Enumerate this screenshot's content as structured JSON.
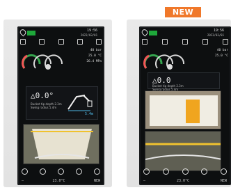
{
  "badge": {
    "label": "NEW",
    "color": "#f0782a"
  },
  "left_screen": {
    "status": {
      "time": "19:56",
      "date": "2023/03/01"
    },
    "readings": [
      "40 bar",
      "25.0 °C",
      "26.4 MPa"
    ],
    "angle": "△0.0°",
    "angle_caption_1": "Bucket tip depth 2.3m",
    "angle_caption_2": "Swing radius 5.4m",
    "distance": "5.4m",
    "footer_left": "—",
    "footer_center": "23.0°C",
    "footer_right": "NEW"
  },
  "right_screen": {
    "status": {
      "time": "19:56",
      "date": "2023/03/01"
    },
    "readings": [
      "40 bar",
      "25.0 °C"
    ],
    "angle": "△0.0",
    "angle_caption_1": "Bucket tip depth 2.3m",
    "angle_caption_2": "Swing radius 5.4m",
    "footer_left": "—",
    "footer_center": "23.0°C",
    "footer_right": "NEW"
  }
}
